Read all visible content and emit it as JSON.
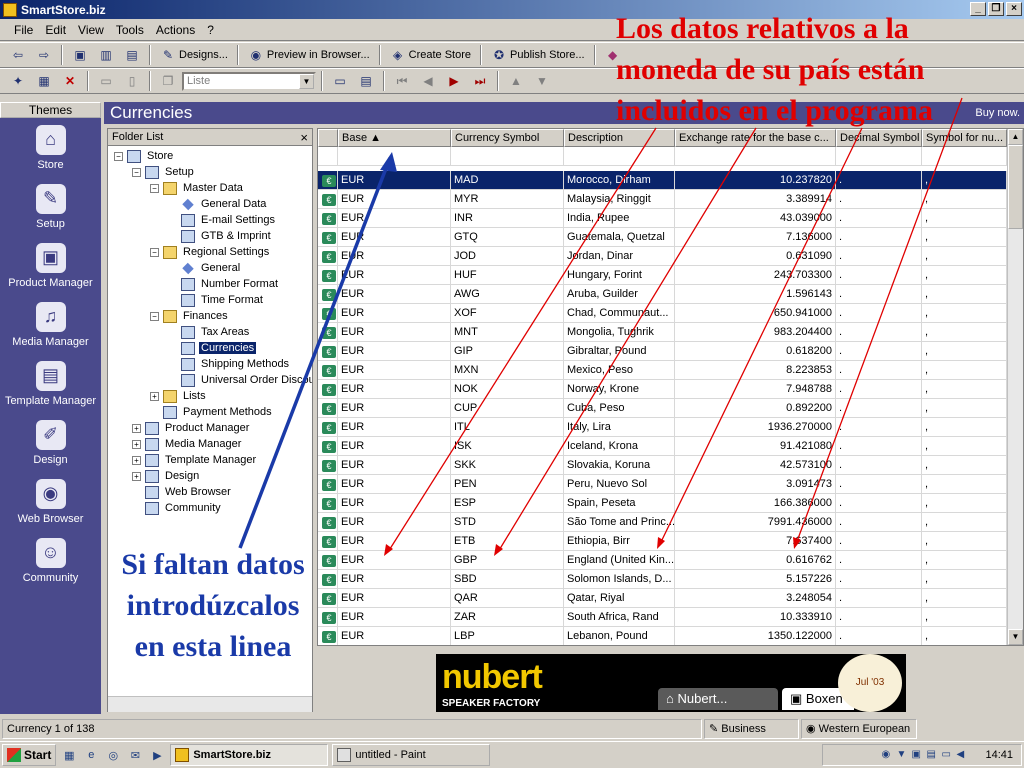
{
  "window": {
    "title": "SmartStore.biz",
    "buttons": [
      "_",
      "❐",
      "×"
    ]
  },
  "menu": [
    "File",
    "Edit",
    "View",
    "Tools",
    "Actions",
    "?"
  ],
  "toolbar1": {
    "designs": "Designs...",
    "preview": "Preview in Browser...",
    "create": "Create Store",
    "publish": "Publish Store..."
  },
  "toolbar2": {
    "combo_value": "Liste"
  },
  "themes": {
    "header": "Themes",
    "items": [
      {
        "label": "Store",
        "icon": "house-icon",
        "glyph": "⌂"
      },
      {
        "label": "Setup",
        "icon": "wrench-icon",
        "glyph": "✎"
      },
      {
        "label": "Product Manager",
        "icon": "box-icon",
        "glyph": "▣"
      },
      {
        "label": "Media Manager",
        "icon": "media-icon",
        "glyph": "♫"
      },
      {
        "label": "Template Manager",
        "icon": "template-icon",
        "glyph": "▤"
      },
      {
        "label": "Design",
        "icon": "brush-icon",
        "glyph": "✐"
      },
      {
        "label": "Web Browser",
        "icon": "globe-icon",
        "glyph": "◉"
      },
      {
        "label": "Community",
        "icon": "people-icon",
        "glyph": "☺"
      }
    ]
  },
  "view": {
    "title": "Currencies",
    "buy_now": "Buy now."
  },
  "folder_list": {
    "header": "Folder List",
    "close": "×",
    "nodes": [
      {
        "label": "Store",
        "depth": 0,
        "exp": "−",
        "icon": "doc"
      },
      {
        "label": "Setup",
        "depth": 1,
        "exp": "−",
        "icon": "doc"
      },
      {
        "label": "Master Data",
        "depth": 2,
        "exp": "−",
        "icon": "folder"
      },
      {
        "label": "General Data",
        "depth": 3,
        "exp": "",
        "icon": "leaf"
      },
      {
        "label": "E-mail Settings",
        "depth": 3,
        "exp": "",
        "icon": "doc"
      },
      {
        "label": "GTB & Imprint",
        "depth": 3,
        "exp": "",
        "icon": "doc"
      },
      {
        "label": "Regional Settings",
        "depth": 2,
        "exp": "−",
        "icon": "folder"
      },
      {
        "label": "General",
        "depth": 3,
        "exp": "",
        "icon": "leaf"
      },
      {
        "label": "Number Format",
        "depth": 3,
        "exp": "",
        "icon": "doc"
      },
      {
        "label": "Time Format",
        "depth": 3,
        "exp": "",
        "icon": "doc"
      },
      {
        "label": "Finances",
        "depth": 2,
        "exp": "−",
        "icon": "folder"
      },
      {
        "label": "Tax Areas",
        "depth": 3,
        "exp": "",
        "icon": "doc"
      },
      {
        "label": "Currencies",
        "depth": 3,
        "exp": "",
        "icon": "doc",
        "selected": true
      },
      {
        "label": "Shipping Methods",
        "depth": 3,
        "exp": "",
        "icon": "doc"
      },
      {
        "label": "Universal Order Discount",
        "depth": 3,
        "exp": "",
        "icon": "doc"
      },
      {
        "label": "Lists",
        "depth": 2,
        "exp": "+",
        "icon": "folder"
      },
      {
        "label": "Payment Methods",
        "depth": 2,
        "exp": "",
        "icon": "doc"
      },
      {
        "label": "Product Manager",
        "depth": 1,
        "exp": "+",
        "icon": "doc"
      },
      {
        "label": "Media Manager",
        "depth": 1,
        "exp": "+",
        "icon": "doc"
      },
      {
        "label": "Template Manager",
        "depth": 1,
        "exp": "+",
        "icon": "doc"
      },
      {
        "label": "Design",
        "depth": 1,
        "exp": "+",
        "icon": "doc"
      },
      {
        "label": "Web Browser",
        "depth": 1,
        "exp": "",
        "icon": "doc"
      },
      {
        "label": "Community",
        "depth": 1,
        "exp": "",
        "icon": "doc"
      }
    ]
  },
  "grid": {
    "columns": [
      "",
      "Base ▲",
      "Currency Symbol",
      "Description",
      "Exchange rate for the base c...",
      "Decimal Symbol",
      "Symbol for nu..."
    ],
    "rows": [
      [
        "EUR",
        "MAD",
        "Morocco, Dirham",
        "10.237820",
        ".",
        ","
      ],
      [
        "EUR",
        "MYR",
        "Malaysia, Ringgit",
        "3.389914",
        ".",
        ","
      ],
      [
        "EUR",
        "INR",
        "India, Rupee",
        "43.039000",
        ".",
        ","
      ],
      [
        "EUR",
        "GTQ",
        "Guatemala, Quetzal",
        "7.136000",
        ".",
        ","
      ],
      [
        "EUR",
        "JOD",
        "Jordan, Dinar",
        "0.631090",
        ".",
        ","
      ],
      [
        "EUR",
        "HUF",
        "Hungary, Forint",
        "243.703300",
        ".",
        ","
      ],
      [
        "EUR",
        "AWG",
        "Aruba, Guilder",
        "1.596143",
        ".",
        ","
      ],
      [
        "EUR",
        "XOF",
        "Chad, Communaut...",
        "650.941000",
        ".",
        ","
      ],
      [
        "EUR",
        "MNT",
        "Mongolia, Tughrik",
        "983.204400",
        ".",
        ","
      ],
      [
        "EUR",
        "GIP",
        "Gibraltar, Pound",
        "0.618200",
        ".",
        ","
      ],
      [
        "EUR",
        "MXN",
        "Mexico, Peso",
        "8.223853",
        ".",
        ","
      ],
      [
        "EUR",
        "NOK",
        "Norway, Krone",
        "7.948788",
        ".",
        ","
      ],
      [
        "EUR",
        "CUP",
        "Cuba, Peso",
        "0.892200",
        ".",
        ","
      ],
      [
        "EUR",
        "ITL",
        "Italy, Lira",
        "1936.270000",
        ".",
        ","
      ],
      [
        "EUR",
        "ISK",
        "Iceland, Krona",
        "91.421080",
        ".",
        ","
      ],
      [
        "EUR",
        "SKK",
        "Slovakia, Koruna",
        "42.573100",
        ".",
        ","
      ],
      [
        "EUR",
        "PEN",
        "Peru, Nuevo Sol",
        "3.091473",
        ".",
        ","
      ],
      [
        "EUR",
        "ESP",
        "Spain, Peseta",
        "166.386000",
        ".",
        ","
      ],
      [
        "EUR",
        "STD",
        "São Tome and Princ...",
        "7991.436000",
        ".",
        ","
      ],
      [
        "EUR",
        "ETB",
        "Ethiopia, Birr",
        "7.637400",
        ".",
        ","
      ],
      [
        "EUR",
        "GBP",
        "England (United Kin...",
        "0.616762",
        ".",
        ","
      ],
      [
        "EUR",
        "SBD",
        "Solomon Islands, D...",
        "5.157226",
        ".",
        ","
      ],
      [
        "EUR",
        "QAR",
        "Qatar, Riyal",
        "3.248054",
        ".",
        ","
      ],
      [
        "EUR",
        "ZAR",
        "South Africa, Rand",
        "10.333910",
        ".",
        ","
      ],
      [
        "EUR",
        "LBP",
        "Lebanon, Pound",
        "1350.122000",
        ".",
        ","
      ]
    ]
  },
  "banner": {
    "brand": "nubert",
    "sub": "SPEAKER FACTORY",
    "tab1": "Nubert...",
    "tab2": "Boxen",
    "badge": "Jul '03"
  },
  "status": {
    "left": "Currency 1 of 138",
    "business": "Business",
    "region": "Western European"
  },
  "taskbar": {
    "start": "Start",
    "task1": "SmartStore.biz",
    "task2": "untitled - Paint",
    "clock": "14:41"
  },
  "annotations": {
    "red": "Los datos relativos a la moneda de su país están incluidos en el programa",
    "blue": "Si faltan datos introdúzcalos en esta linea"
  },
  "colors": {
    "title_active": "#0a246a",
    "theme_bar": "#4a4a8c",
    "annotation_red": "#e00000",
    "annotation_blue": "#1a3aa8"
  }
}
